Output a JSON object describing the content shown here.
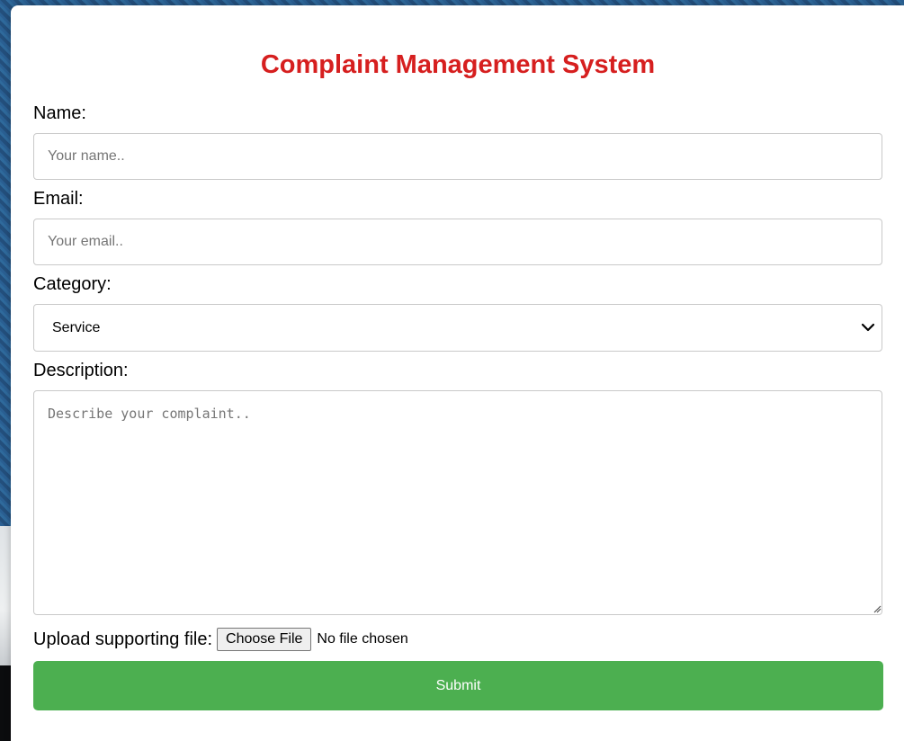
{
  "header": {
    "title": "Complaint Management System"
  },
  "form": {
    "name": {
      "label": "Name:",
      "placeholder": "Your name.."
    },
    "email": {
      "label": "Email:",
      "placeholder": "Your email.."
    },
    "category": {
      "label": "Category:",
      "selected": "Service"
    },
    "description": {
      "label": "Description:",
      "placeholder": "Describe your complaint.."
    },
    "upload": {
      "label": "Upload supporting file:",
      "button_label": "Choose File",
      "status": "No file chosen"
    },
    "submit_label": "Submit"
  },
  "colors": {
    "title": "#d61f1f",
    "submit": "#4caf50",
    "panel": "#ffffff"
  },
  "icons": {
    "category_dropdown": "chevron-down-icon",
    "textarea_resize": "resize-grip-icon"
  }
}
